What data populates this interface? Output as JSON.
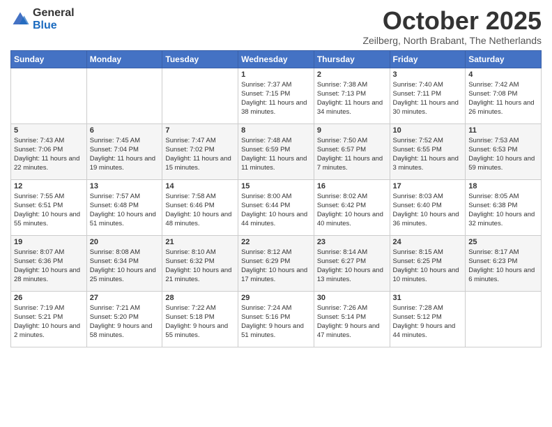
{
  "logo": {
    "general": "General",
    "blue": "Blue"
  },
  "header": {
    "month": "October 2025",
    "location": "Zeilberg, North Brabant, The Netherlands"
  },
  "weekdays": [
    "Sunday",
    "Monday",
    "Tuesday",
    "Wednesday",
    "Thursday",
    "Friday",
    "Saturday"
  ],
  "weeks": [
    [
      {
        "day": "",
        "sunrise": "",
        "sunset": "",
        "daylight": ""
      },
      {
        "day": "",
        "sunrise": "",
        "sunset": "",
        "daylight": ""
      },
      {
        "day": "",
        "sunrise": "",
        "sunset": "",
        "daylight": ""
      },
      {
        "day": "1",
        "sunrise": "Sunrise: 7:37 AM",
        "sunset": "Sunset: 7:15 PM",
        "daylight": "Daylight: 11 hours and 38 minutes."
      },
      {
        "day": "2",
        "sunrise": "Sunrise: 7:38 AM",
        "sunset": "Sunset: 7:13 PM",
        "daylight": "Daylight: 11 hours and 34 minutes."
      },
      {
        "day": "3",
        "sunrise": "Sunrise: 7:40 AM",
        "sunset": "Sunset: 7:11 PM",
        "daylight": "Daylight: 11 hours and 30 minutes."
      },
      {
        "day": "4",
        "sunrise": "Sunrise: 7:42 AM",
        "sunset": "Sunset: 7:08 PM",
        "daylight": "Daylight: 11 hours and 26 minutes."
      }
    ],
    [
      {
        "day": "5",
        "sunrise": "Sunrise: 7:43 AM",
        "sunset": "Sunset: 7:06 PM",
        "daylight": "Daylight: 11 hours and 22 minutes."
      },
      {
        "day": "6",
        "sunrise": "Sunrise: 7:45 AM",
        "sunset": "Sunset: 7:04 PM",
        "daylight": "Daylight: 11 hours and 19 minutes."
      },
      {
        "day": "7",
        "sunrise": "Sunrise: 7:47 AM",
        "sunset": "Sunset: 7:02 PM",
        "daylight": "Daylight: 11 hours and 15 minutes."
      },
      {
        "day": "8",
        "sunrise": "Sunrise: 7:48 AM",
        "sunset": "Sunset: 6:59 PM",
        "daylight": "Daylight: 11 hours and 11 minutes."
      },
      {
        "day": "9",
        "sunrise": "Sunrise: 7:50 AM",
        "sunset": "Sunset: 6:57 PM",
        "daylight": "Daylight: 11 hours and 7 minutes."
      },
      {
        "day": "10",
        "sunrise": "Sunrise: 7:52 AM",
        "sunset": "Sunset: 6:55 PM",
        "daylight": "Daylight: 11 hours and 3 minutes."
      },
      {
        "day": "11",
        "sunrise": "Sunrise: 7:53 AM",
        "sunset": "Sunset: 6:53 PM",
        "daylight": "Daylight: 10 hours and 59 minutes."
      }
    ],
    [
      {
        "day": "12",
        "sunrise": "Sunrise: 7:55 AM",
        "sunset": "Sunset: 6:51 PM",
        "daylight": "Daylight: 10 hours and 55 minutes."
      },
      {
        "day": "13",
        "sunrise": "Sunrise: 7:57 AM",
        "sunset": "Sunset: 6:48 PM",
        "daylight": "Daylight: 10 hours and 51 minutes."
      },
      {
        "day": "14",
        "sunrise": "Sunrise: 7:58 AM",
        "sunset": "Sunset: 6:46 PM",
        "daylight": "Daylight: 10 hours and 48 minutes."
      },
      {
        "day": "15",
        "sunrise": "Sunrise: 8:00 AM",
        "sunset": "Sunset: 6:44 PM",
        "daylight": "Daylight: 10 hours and 44 minutes."
      },
      {
        "day": "16",
        "sunrise": "Sunrise: 8:02 AM",
        "sunset": "Sunset: 6:42 PM",
        "daylight": "Daylight: 10 hours and 40 minutes."
      },
      {
        "day": "17",
        "sunrise": "Sunrise: 8:03 AM",
        "sunset": "Sunset: 6:40 PM",
        "daylight": "Daylight: 10 hours and 36 minutes."
      },
      {
        "day": "18",
        "sunrise": "Sunrise: 8:05 AM",
        "sunset": "Sunset: 6:38 PM",
        "daylight": "Daylight: 10 hours and 32 minutes."
      }
    ],
    [
      {
        "day": "19",
        "sunrise": "Sunrise: 8:07 AM",
        "sunset": "Sunset: 6:36 PM",
        "daylight": "Daylight: 10 hours and 28 minutes."
      },
      {
        "day": "20",
        "sunrise": "Sunrise: 8:08 AM",
        "sunset": "Sunset: 6:34 PM",
        "daylight": "Daylight: 10 hours and 25 minutes."
      },
      {
        "day": "21",
        "sunrise": "Sunrise: 8:10 AM",
        "sunset": "Sunset: 6:32 PM",
        "daylight": "Daylight: 10 hours and 21 minutes."
      },
      {
        "day": "22",
        "sunrise": "Sunrise: 8:12 AM",
        "sunset": "Sunset: 6:29 PM",
        "daylight": "Daylight: 10 hours and 17 minutes."
      },
      {
        "day": "23",
        "sunrise": "Sunrise: 8:14 AM",
        "sunset": "Sunset: 6:27 PM",
        "daylight": "Daylight: 10 hours and 13 minutes."
      },
      {
        "day": "24",
        "sunrise": "Sunrise: 8:15 AM",
        "sunset": "Sunset: 6:25 PM",
        "daylight": "Daylight: 10 hours and 10 minutes."
      },
      {
        "day": "25",
        "sunrise": "Sunrise: 8:17 AM",
        "sunset": "Sunset: 6:23 PM",
        "daylight": "Daylight: 10 hours and 6 minutes."
      }
    ],
    [
      {
        "day": "26",
        "sunrise": "Sunrise: 7:19 AM",
        "sunset": "Sunset: 5:21 PM",
        "daylight": "Daylight: 10 hours and 2 minutes."
      },
      {
        "day": "27",
        "sunrise": "Sunrise: 7:21 AM",
        "sunset": "Sunset: 5:20 PM",
        "daylight": "Daylight: 9 hours and 58 minutes."
      },
      {
        "day": "28",
        "sunrise": "Sunrise: 7:22 AM",
        "sunset": "Sunset: 5:18 PM",
        "daylight": "Daylight: 9 hours and 55 minutes."
      },
      {
        "day": "29",
        "sunrise": "Sunrise: 7:24 AM",
        "sunset": "Sunset: 5:16 PM",
        "daylight": "Daylight: 9 hours and 51 minutes."
      },
      {
        "day": "30",
        "sunrise": "Sunrise: 7:26 AM",
        "sunset": "Sunset: 5:14 PM",
        "daylight": "Daylight: 9 hours and 47 minutes."
      },
      {
        "day": "31",
        "sunrise": "Sunrise: 7:28 AM",
        "sunset": "Sunset: 5:12 PM",
        "daylight": "Daylight: 9 hours and 44 minutes."
      },
      {
        "day": "",
        "sunrise": "",
        "sunset": "",
        "daylight": ""
      }
    ]
  ]
}
